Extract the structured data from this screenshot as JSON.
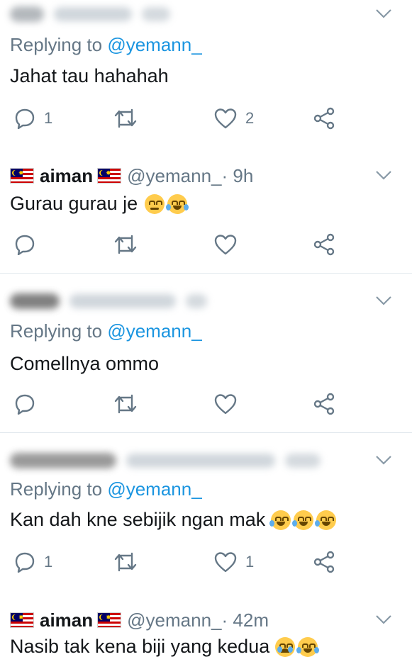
{
  "tweets": [
    {
      "author_hidden": true,
      "replying_prefix": "Replying to ",
      "replying_to": "@yemann_",
      "text": "Jahat tau hahahah",
      "emojis": [],
      "counts": {
        "reply": "1",
        "retweet": "",
        "like": "2"
      }
    },
    {
      "name": "aiman",
      "handle": "@yemann_",
      "time": " · 9h",
      "text": "Gurau gurau je",
      "emojis": [
        "rolling-eyes-emoji",
        "tears-of-joy-emoji"
      ],
      "counts": {
        "reply": "",
        "retweet": "",
        "like": ""
      }
    },
    {
      "author_hidden": true,
      "replying_prefix": "Replying to ",
      "replying_to": "@yemann_",
      "text": "Comellnya ommo",
      "emojis": [],
      "counts": {
        "reply": "",
        "retweet": "",
        "like": ""
      }
    },
    {
      "author_hidden": true,
      "replying_prefix": "Replying to ",
      "replying_to": "@yemann_",
      "text": "Kan dah kne sebijik ngan mak",
      "emojis": [
        "rofl-emoji",
        "rofl-emoji",
        "rofl-emoji"
      ],
      "counts": {
        "reply": "1",
        "retweet": "",
        "like": "1"
      }
    },
    {
      "name": "aiman",
      "handle": "@yemann_",
      "time": " · 42m",
      "text": "Nasib tak kena biji yang kedua",
      "emojis": [
        "crying-emoji",
        "tears-of-joy-emoji"
      ]
    }
  ],
  "colors": {
    "text": "#14171a",
    "secondary": "#657786",
    "link": "#1b95e0",
    "divider": "#e1e8ed"
  },
  "icons": [
    "reply-icon",
    "retweet-icon",
    "like-icon",
    "share-icon",
    "chevron-down-icon",
    "malaysia-flag-icon"
  ]
}
